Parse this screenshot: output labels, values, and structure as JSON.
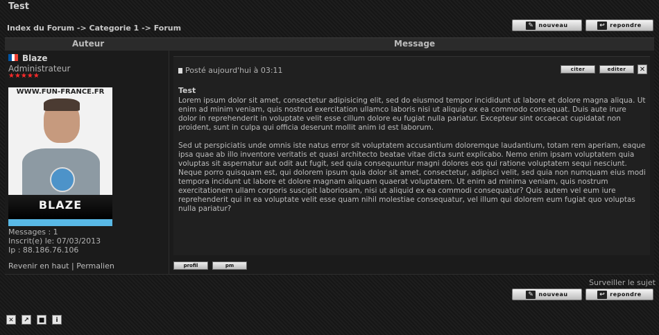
{
  "topic": {
    "title": "Test"
  },
  "breadcrumb": {
    "text": "Index du Forum -> Categorie 1 -> Forum"
  },
  "actions": {
    "new_label": "nouveau",
    "reply_label": "repondre"
  },
  "table": {
    "author_header": "Auteur",
    "message_header": "Message"
  },
  "author": {
    "name": "Blaze",
    "rank": "Administrateur",
    "stars": "★★★★★",
    "avatar_site": "WWW.FUN-FRANCE.FR",
    "avatar_name": "BLAZE",
    "messages": "Messages : 1",
    "joined": "Inscrit(e) le: 07/03/2013",
    "ip": "Ip : 88.186.76.106"
  },
  "post": {
    "posted": "Posté aujourd'hui à 03:11",
    "quote_label": "citer",
    "edit_label": "editer",
    "title": "Test",
    "paragraph1": "Lorem ipsum dolor sit amet, consectetur adipisicing elit, sed do eiusmod tempor incididunt ut labore et dolore magna aliqua. Ut enim ad minim veniam, quis nostrud exercitation ullamco laboris nisi ut aliquip ex ea commodo consequat. Duis aute irure dolor in reprehenderit in voluptate velit esse cillum dolore eu fugiat nulla pariatur. Excepteur sint occaecat cupidatat non proident, sunt in culpa qui officia deserunt mollit anim id est laborum.",
    "paragraph2": "Sed ut perspiciatis unde omnis iste natus error sit voluptatem accusantium doloremque laudantium, totam rem aperiam, eaque ipsa quae ab illo inventore veritatis et quasi architecto beatae vitae dicta sunt explicabo. Nemo enim ipsam voluptatem quia voluptas sit aspernatur aut odit aut fugit, sed quia consequuntur magni dolores eos qui ratione voluptatem sequi nesciunt. Neque porro quisquam est, qui dolorem ipsum quia dolor sit amet, consectetur, adipisci velit, sed quia non numquam eius modi tempora incidunt ut labore et dolore magnam aliquam quaerat voluptatem. Ut enim ad minima veniam, quis nostrum exercitationem ullam corporis suscipit laboriosam, nisi ut aliquid ex ea commodi consequatur? Quis autem vel eum iure reprehenderit qui in ea voluptate velit esse quam nihil molestiae consequatur, vel illum qui dolorem eum fugiat quo voluptas nulla pariatur?"
  },
  "footer": {
    "back_top": "Revenir en haut",
    "separator": "|",
    "permalink": "Permalien",
    "profile_label": "profil",
    "pm_label": "pm",
    "watch": "Surveiller le sujet"
  },
  "colors": {
    "stars": "#ff2b2b",
    "flag_blue": "#0055a4",
    "flag_red": "#ef4135"
  },
  "icons": [
    "close-icon",
    "move-icon",
    "lock-icon",
    "info-icon"
  ]
}
